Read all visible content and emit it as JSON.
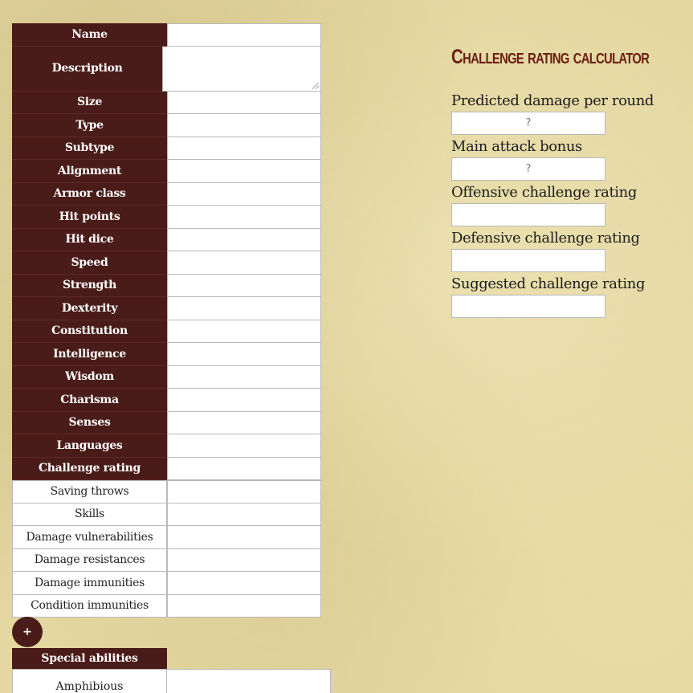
{
  "stat_block": {
    "required_fields": [
      {
        "label": "Name",
        "value": ""
      },
      {
        "label": "Description",
        "value": ""
      },
      {
        "label": "Size",
        "value": ""
      },
      {
        "label": "Type",
        "value": ""
      },
      {
        "label": "Subtype",
        "value": ""
      },
      {
        "label": "Alignment",
        "value": ""
      },
      {
        "label": "Armor class",
        "value": ""
      },
      {
        "label": "Hit points",
        "value": ""
      },
      {
        "label": "Hit dice",
        "value": ""
      },
      {
        "label": "Speed",
        "value": ""
      },
      {
        "label": "Strength",
        "value": ""
      },
      {
        "label": "Dexterity",
        "value": ""
      },
      {
        "label": "Constitution",
        "value": ""
      },
      {
        "label": "Intelligence",
        "value": ""
      },
      {
        "label": "Wisdom",
        "value": ""
      },
      {
        "label": "Charisma",
        "value": ""
      },
      {
        "label": "Senses",
        "value": ""
      },
      {
        "label": "Languages",
        "value": ""
      },
      {
        "label": "Challenge rating",
        "value": ""
      }
    ],
    "optional_fields": [
      {
        "label": "Saving throws",
        "value": ""
      },
      {
        "label": "Skills",
        "value": ""
      },
      {
        "label": "Damage vulnerabilities",
        "value": ""
      },
      {
        "label": "Damage resistances",
        "value": ""
      },
      {
        "label": "Damage immunities",
        "value": ""
      },
      {
        "label": "Condition immunities",
        "value": ""
      }
    ],
    "add_button_label": "+",
    "special_abilities": {
      "header": "Special abilities",
      "items": [
        {
          "label": "Amphibious",
          "value": ""
        }
      ]
    }
  },
  "calculator": {
    "title": "Challenge rating calculator",
    "fields": [
      {
        "label": "Predicted damage per round",
        "placeholder": "?"
      },
      {
        "label": "Main attack bonus",
        "placeholder": "?"
      },
      {
        "label": "Offensive challenge rating",
        "placeholder": ""
      },
      {
        "label": "Defensive challenge rating",
        "placeholder": ""
      },
      {
        "label": "Suggested challenge rating",
        "placeholder": ""
      }
    ]
  },
  "colors": {
    "header_background": "#4a1c19",
    "title_color": "#6b1d12",
    "parchment": "#e4d7a2"
  }
}
